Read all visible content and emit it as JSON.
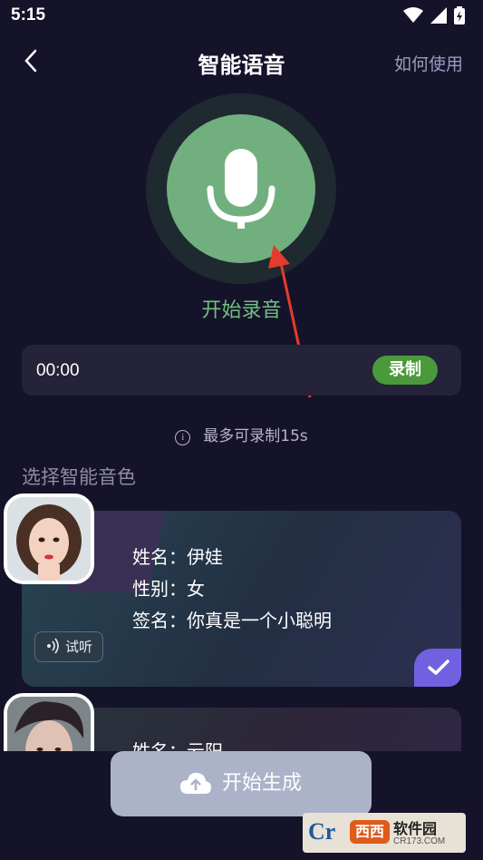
{
  "status_bar": {
    "time": "5:15"
  },
  "header": {
    "title": "智能语音",
    "help_link": "如何使用"
  },
  "record": {
    "label": "开始录音",
    "elapsed": "00:00",
    "record_button": "录制",
    "hint": "最多可录制15s"
  },
  "voices": {
    "section_title": "选择智能音色",
    "items": [
      {
        "name_line": "姓名：伊娃",
        "gender_line": "性别：女",
        "signature_line": "签名：你真是一个小聪明",
        "listen_label": "试听",
        "selected": true
      },
      {
        "name_line": "姓名：云阳",
        "selected": false
      }
    ]
  },
  "generate_button": "开始生成",
  "watermark": {
    "brand": "软件园",
    "badge": "西西",
    "url": "CR173.COM",
    "prefix": "Cr"
  },
  "colors": {
    "background": "#15132a",
    "mic_green": "#71b07e",
    "record_green": "#4a9a3c",
    "check_purple": "#7160e0",
    "arrow_red": "#e53b2c"
  }
}
